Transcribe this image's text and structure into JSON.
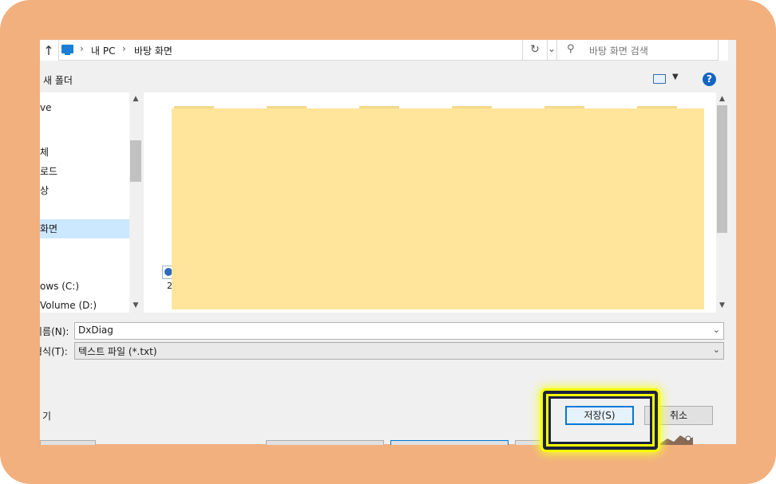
{
  "address": {
    "crumbs": [
      "내 PC",
      "바탕 화면"
    ],
    "search_placeholder": "바탕 화면 검색"
  },
  "toolbar": {
    "new_folder": "새 폴더"
  },
  "nav": {
    "items": [
      "ve",
      "체",
      "로드",
      "상",
      "화면",
      "ows (C:)",
      "Volume (D:)"
    ],
    "selected_index": 4
  },
  "files": {
    "caption_line1": "2",
    "caption_line2": "&#x2022;"
  },
  "form": {
    "filename_label": "이름(N):",
    "filename_value": "DxDiag",
    "type_label": "형식(T):",
    "type_value": "텍스트 파일 (*.txt)"
  },
  "footer": {
    "hide_folders": "기",
    "save_label": "저장(S)",
    "cancel_label": "취소"
  },
  "colors": {
    "frame": "#f2b07f",
    "highlight_glow": "#f7ff00",
    "highlight_border": "#1b2240",
    "selection": "#cce8ff",
    "redaction": "#ffe59b"
  }
}
